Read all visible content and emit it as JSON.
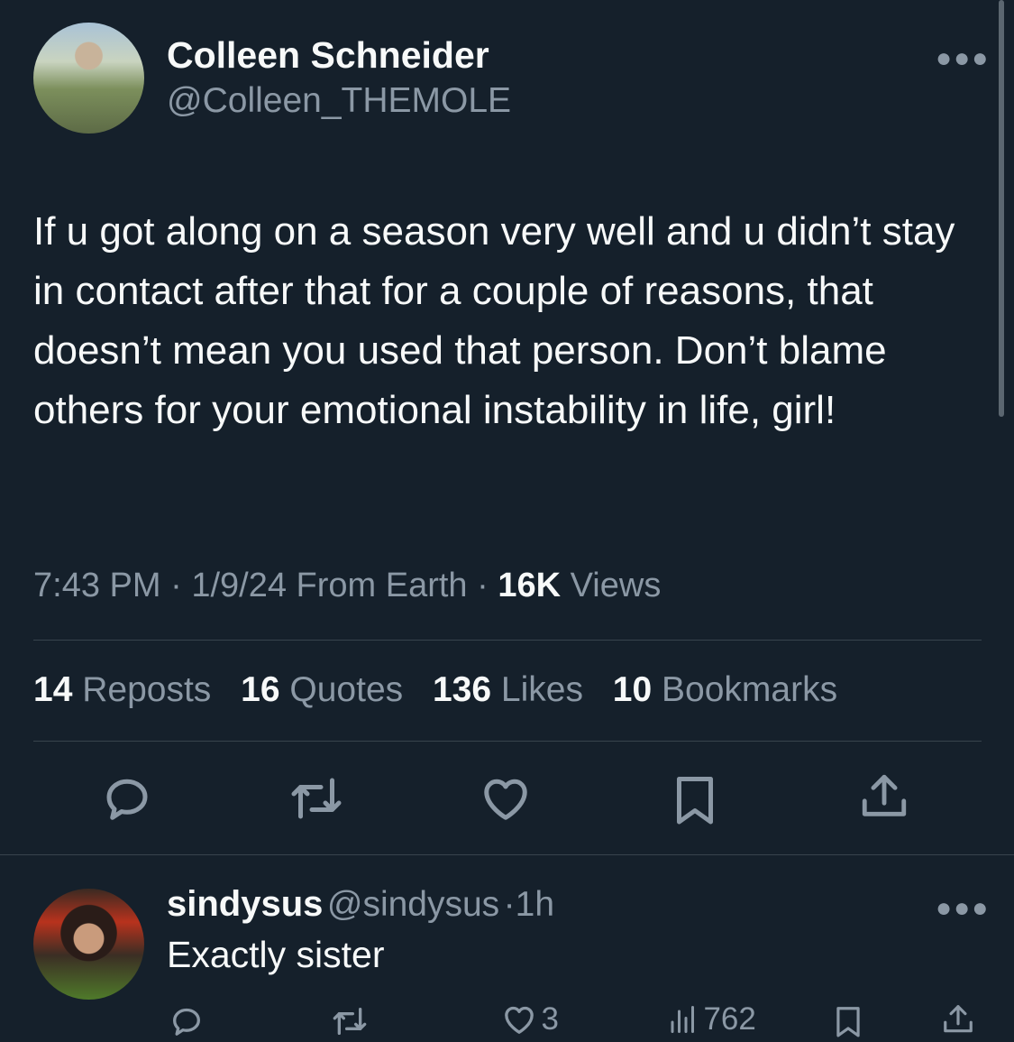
{
  "tweet": {
    "author_name": "Colleen Schneider",
    "author_handle": "@Colleen_THEMOLE",
    "text": "If u got along on a season very well and u didn’t stay in contact after that for a couple of reasons, that doesn’t mean you used that person. Don’t blame others for your emotional instability in life, girl!",
    "time": "7:43 PM",
    "date": "1/9/24",
    "location": "From Earth",
    "views_count": "16K",
    "views_label": "Views",
    "reposts_count": "14",
    "reposts_label": "Reposts",
    "quotes_count": "16",
    "quotes_label": "Quotes",
    "likes_count": "136",
    "likes_label": "Likes",
    "bookmarks_count": "10",
    "bookmarks_label": "Bookmarks",
    "more_icon": "more-dots-icon",
    "action_icons": [
      "reply-icon",
      "repost-icon",
      "like-icon",
      "bookmark-icon",
      "share-icon"
    ]
  },
  "reply": {
    "author_name": "sindysus",
    "author_handle": "@sindysus",
    "time": "1h",
    "text": "Exactly sister",
    "likes": "3",
    "views": "762"
  },
  "colors": {
    "background": "#15202b",
    "text": "#f7f9f9",
    "secondary": "#8b98a5",
    "divider": "#38444d"
  }
}
